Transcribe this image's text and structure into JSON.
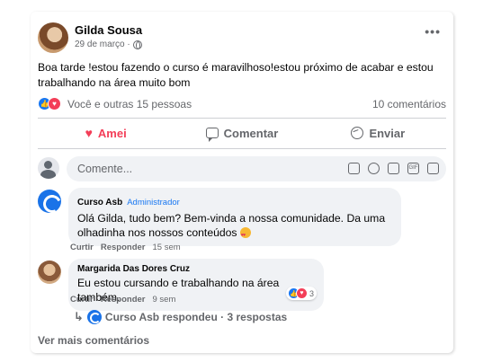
{
  "post": {
    "author": "Gilda Sousa",
    "date": "29 de março · ",
    "more_label": "•••",
    "text": "Boa tarde !estou fazendo o curso é maravilhoso!estou próximo de acabar e estou trabalhando na área muito bom",
    "reactions_text": "Você e outras 15 pessoas",
    "comments_count": "10 comentários"
  },
  "actions": {
    "love_label": "Amei",
    "comment_label": "Comentar",
    "share_label": "Enviar"
  },
  "composer": {
    "placeholder": "Comente..."
  },
  "comments": [
    {
      "name": "Curso Asb",
      "role": "Administrador",
      "text": "Olá Gilda, tudo bem? Bem-vinda a nossa comunidade. Da uma olhadinha nos nossos conteúdos",
      "like": "Curtir",
      "reply": "Responder",
      "time": "15 sem"
    },
    {
      "name": "Margarida Das Dores Cruz",
      "text": "Eu estou cursando e trabalhando na área também.",
      "like": "Curtir",
      "reply": "Responder",
      "time": "9 sem",
      "reaction_count": "3"
    }
  ],
  "replies": {
    "text": "Curso Asb respondeu · 3 respostas"
  },
  "see_more": "Ver mais comentários",
  "colors": {
    "like_blue": "#1877f2",
    "love_red": "#f33e58",
    "muted": "#65676b"
  }
}
